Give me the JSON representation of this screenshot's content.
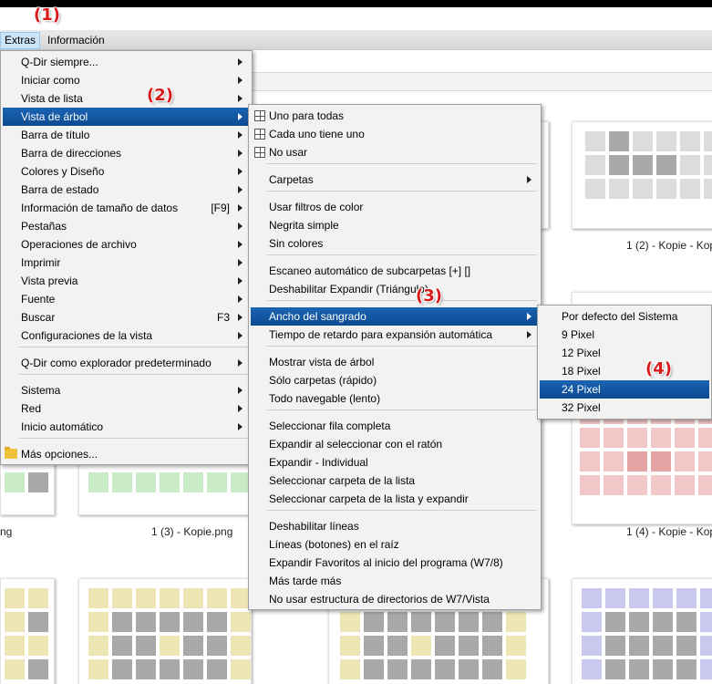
{
  "callouts": [
    "(1)",
    "(2)",
    "(3)",
    "(4)"
  ],
  "menubar": {
    "items": [
      "Extras",
      "Información"
    ]
  },
  "captions": [
    "1 (2) - Kopie - Kop",
    "ng",
    "1 (3) - Kopie.png",
    "1 (4) - Kopie - Kop"
  ],
  "extras_menu": {
    "items": [
      {
        "label": "Q-Dir siempre...",
        "shortcut": "",
        "submenu": true
      },
      {
        "label": "Iniciar como",
        "shortcut": "",
        "submenu": true
      },
      {
        "label": "Vista de lista",
        "shortcut": "",
        "submenu": true
      },
      {
        "label": "Vista de árbol",
        "shortcut": "",
        "submenu": true
      },
      {
        "label": "Barra de título",
        "shortcut": "",
        "submenu": true
      },
      {
        "label": "Barra de direcciones",
        "shortcut": "",
        "submenu": true
      },
      {
        "label": "Colores y Diseño",
        "shortcut": "",
        "submenu": true
      },
      {
        "label": "Barra de estado",
        "shortcut": "",
        "submenu": true
      },
      {
        "label": "Información de tamaño de datos",
        "shortcut": "[F9]",
        "submenu": true
      },
      {
        "label": "Pestañas",
        "shortcut": "",
        "submenu": true
      },
      {
        "label": "Operaciones de archivo",
        "shortcut": "",
        "submenu": true
      },
      {
        "label": "Imprimir",
        "shortcut": "",
        "submenu": true
      },
      {
        "label": "Vista previa",
        "shortcut": "",
        "submenu": true
      },
      {
        "label": "Fuente",
        "shortcut": "",
        "submenu": true
      },
      {
        "label": "Buscar",
        "shortcut": "F3",
        "submenu": true
      },
      {
        "label": "Configuraciones de la vista",
        "shortcut": "",
        "submenu": true
      },
      {
        "label": "Q-Dir como explorador predeterminado",
        "shortcut": "",
        "submenu": true
      },
      {
        "label": "Sistema",
        "shortcut": "",
        "submenu": true
      },
      {
        "label": "Red",
        "shortcut": "",
        "submenu": true
      },
      {
        "label": "Inicio automático",
        "shortcut": "",
        "submenu": true
      },
      {
        "label": "Más opciones...",
        "shortcut": "",
        "submenu": false
      }
    ]
  },
  "tree_menu": {
    "items": [
      {
        "label": "Uno para todas",
        "submenu": false
      },
      {
        "label": "Cada uno tiene uno",
        "submenu": false
      },
      {
        "label": "No usar",
        "submenu": false
      },
      {
        "label": "Carpetas",
        "submenu": true
      },
      {
        "label": "Usar filtros de color",
        "submenu": false
      },
      {
        "label": "Negrita simple",
        "submenu": false
      },
      {
        "label": "Sin colores",
        "submenu": false
      },
      {
        "label": "Escaneo automático de subcarpetas [+] []",
        "submenu": false
      },
      {
        "label": "Deshabilitar Expandir (Triángulo)",
        "submenu": false
      },
      {
        "label": "Ancho del sangrado",
        "submenu": true
      },
      {
        "label": "Tiempo de retardo para expansión automática",
        "submenu": true
      },
      {
        "label": "Mostrar vista de árbol",
        "submenu": false
      },
      {
        "label": "Sólo carpetas (rápido)",
        "submenu": false
      },
      {
        "label": "Todo navegable (lento)",
        "submenu": false
      },
      {
        "label": "Seleccionar fila completa",
        "submenu": false
      },
      {
        "label": "Expandir al seleccionar con el ratón",
        "submenu": false
      },
      {
        "label": "Expandir - Individual",
        "submenu": false
      },
      {
        "label": "Seleccionar carpeta de la lista",
        "submenu": false
      },
      {
        "label": "Seleccionar carpeta de la lista y expandir",
        "submenu": false
      },
      {
        "label": "Deshabilitar líneas",
        "submenu": false
      },
      {
        "label": "Líneas (botones) en el raíz",
        "submenu": false
      },
      {
        "label": "Expandir Favoritos al inicio del programa (W7/8)",
        "submenu": false
      },
      {
        "label": "Más tarde más",
        "submenu": false
      },
      {
        "label": "No usar estructura de directorios de W7/Vista",
        "submenu": false
      }
    ]
  },
  "indent_menu": {
    "items": [
      "Por defecto del Sistema",
      "9 Pixel",
      "12 Pixel",
      "18 Pixel",
      "24 Pixel",
      "32 Pixel"
    ]
  },
  "colors": {
    "highlight": "#0c4a91",
    "callout": "#d91a1a"
  }
}
